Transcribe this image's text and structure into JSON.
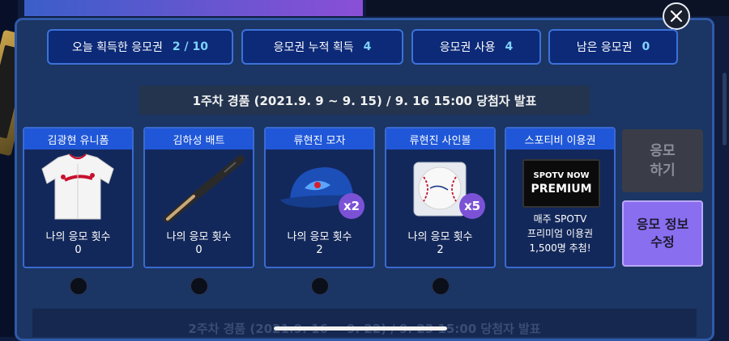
{
  "stats": [
    {
      "label": "오늘 획득한 응모권",
      "value": "2 / 10"
    },
    {
      "label": "응모권 누적 획득",
      "value": "4"
    },
    {
      "label": "응모권 사용",
      "value": "4"
    },
    {
      "label": "남은 응모권",
      "value": "0"
    }
  ],
  "week1_header": "1주차 경품 (2021.9. 9 ~ 9. 15) / 9. 16 15:00 당첨자 발표",
  "prizes": [
    {
      "title": "김광현 유니폼",
      "entry_label": "나의 응모 횟수",
      "entry_count": "0",
      "icon": "jersey-icon"
    },
    {
      "title": "김하성 배트",
      "entry_label": "나의 응모 횟수",
      "entry_count": "0",
      "icon": "bat-icon"
    },
    {
      "title": "류현진 모자",
      "entry_label": "나의 응모 횟수",
      "entry_count": "2",
      "badge": "x2",
      "icon": "cap-icon"
    },
    {
      "title": "류현진 사인볼",
      "entry_label": "나의 응모 횟수",
      "entry_count": "2",
      "badge": "x5",
      "icon": "signed-ball-icon"
    },
    {
      "title": "스포티비 이용권",
      "desc": [
        "매주 SPOTV",
        "프리미엄 이용권",
        "1,500명 추첨!"
      ],
      "logo_top": "SPOTV NOW",
      "logo_bottom": "PREMIUM",
      "icon": "spotv-logo-icon"
    }
  ],
  "enter_button": {
    "line1": "응모",
    "line2": "하기"
  },
  "edit_button": {
    "line1": "응모 정보",
    "line2": "수정"
  },
  "week2_header": "2주차 경품 (2021.9. 16 ~ 9. 22) / 9. 23 15:00 당첨자 발표",
  "colors": {
    "panel": "#1b3564",
    "accent": "#3c72d8",
    "value": "#7fd3ff",
    "edit_button": "#8a6ef0"
  }
}
